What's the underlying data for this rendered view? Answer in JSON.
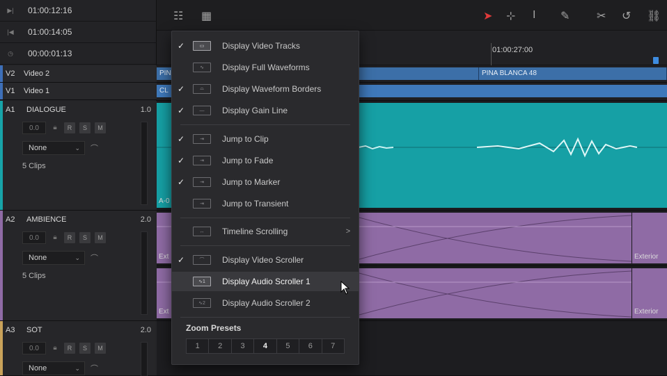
{
  "timecodes": {
    "in": "01:00:12:16",
    "out": "01:00:14:05",
    "duration": "00:00:01:13"
  },
  "ruler": {
    "label": "01:00:27:00"
  },
  "tracks": {
    "v2": {
      "id": "V2",
      "name": "Video 2"
    },
    "v1": {
      "id": "V1",
      "name": "Video 1"
    },
    "a1": {
      "id": "A1",
      "name": "DIALOGUE",
      "channels": "1.0",
      "volume": "0.0",
      "dropdown": "None",
      "clips": "5 Clips"
    },
    "a2": {
      "id": "A2",
      "name": "AMBIENCE",
      "channels": "2.0",
      "volume": "0.0",
      "dropdown": "None",
      "clips": "5 Clips"
    },
    "a3": {
      "id": "A3",
      "name": "SOT",
      "channels": "2.0",
      "volume": "0.0",
      "dropdown": "None"
    }
  },
  "buttons": {
    "r": "R",
    "s": "S",
    "m": "M"
  },
  "clips": {
    "v2_a": "PIN",
    "v2_b": "PINA BLANCA 48",
    "v1_a": "CL",
    "a1_label": "A-0",
    "a2_left": "Ext",
    "a2_right": "Exterior",
    "a2b_left": "Ext",
    "a2b_right": "Exterior"
  },
  "menu": {
    "items": [
      {
        "label": "Display Video Tracks",
        "checked": "✓",
        "icon": "video-tracks-icon"
      },
      {
        "label": "Display Full Waveforms",
        "checked": "",
        "icon": "full-waveform-icon"
      },
      {
        "label": "Display Waveform Borders",
        "checked": "✓",
        "icon": "waveform-border-icon"
      },
      {
        "label": "Display Gain Line",
        "checked": "✓",
        "icon": "gain-line-icon"
      },
      {
        "label": "Jump to Clip",
        "checked": "✓",
        "icon": "jump-clip-icon"
      },
      {
        "label": "Jump to Fade",
        "checked": "✓",
        "icon": "jump-fade-icon"
      },
      {
        "label": "Jump to Marker",
        "checked": "✓",
        "icon": "jump-marker-icon"
      },
      {
        "label": "Jump to Transient",
        "checked": "",
        "icon": "jump-transient-icon"
      },
      {
        "label": "Timeline Scrolling",
        "checked": "",
        "icon": "timeline-scroll-icon",
        "arrow": ">"
      },
      {
        "label": "Display Video Scroller",
        "checked": "✓",
        "icon": "video-scroller-icon"
      },
      {
        "label": "Display Audio Scroller 1",
        "checked": "",
        "icon": "audio-scroller-1-icon"
      },
      {
        "label": "Display Audio Scroller 2",
        "checked": "",
        "icon": "audio-scroller-2-icon"
      }
    ],
    "zoom_title": "Zoom Presets",
    "zoom": [
      "1",
      "2",
      "3",
      "4",
      "5",
      "6",
      "7"
    ],
    "zoom_active": "4"
  },
  "colors": {
    "teal_clip": "#16a0a5",
    "purple_clip": "#8f6ba5",
    "blue_clip": "#3f79bb",
    "selection_tool": "#e03a3a"
  }
}
